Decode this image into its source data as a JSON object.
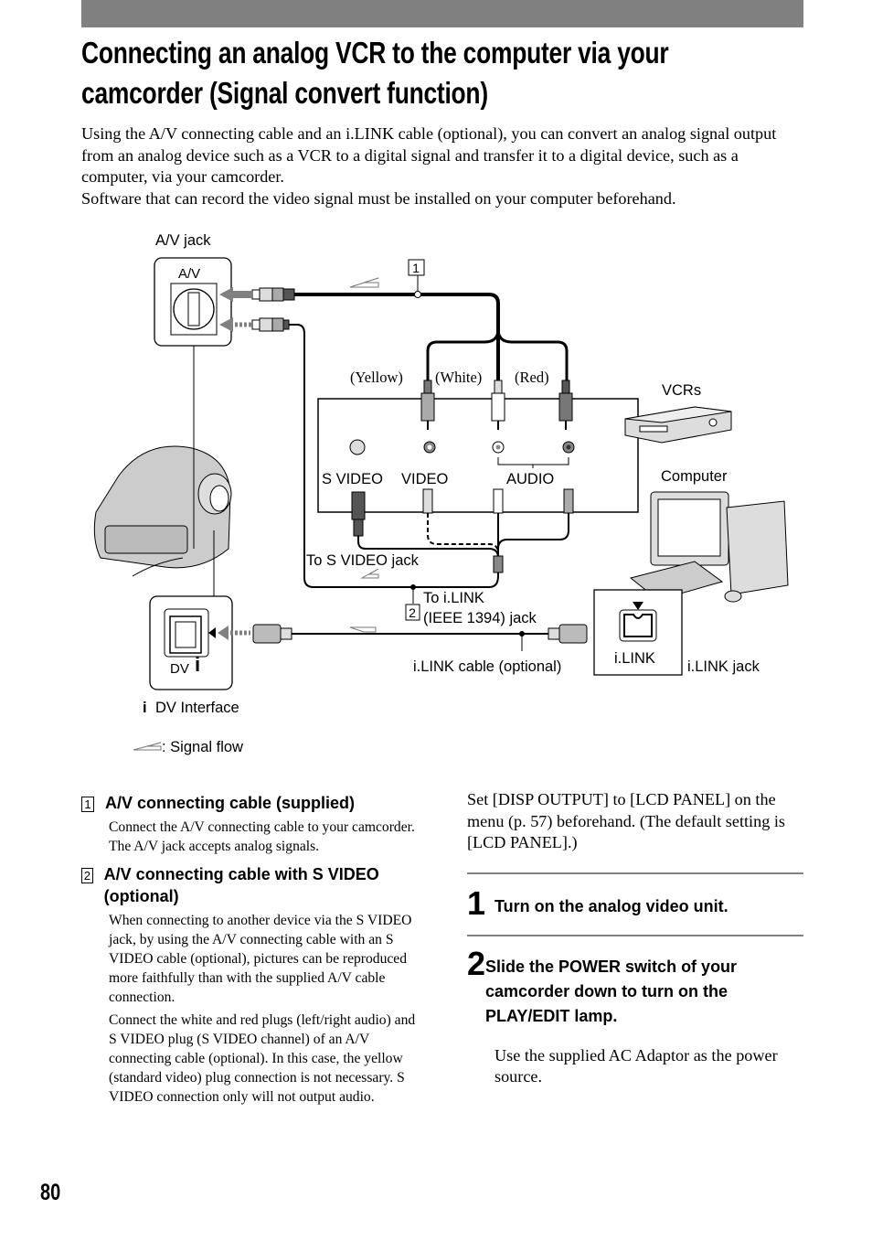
{
  "page": {
    "title_line1": "Connecting an analog VCR to the computer via your",
    "title_line2": "camcorder (Signal convert function)",
    "intro": [
      "Using the A/V connecting cable and an i.LINK cable (optional), you can convert an analog signal output from an analog device such as a VCR to a digital signal and transfer it to a digital device, such as a computer, via your camcorder.",
      "Software that can record the video signal must be installed on your computer beforehand."
    ],
    "page_number": "80"
  },
  "diagram": {
    "av_jack_label": "A/V jack",
    "av_port_label": "A/V",
    "callout_1": "1",
    "callout_2": "2",
    "yellow": "(Yellow)",
    "white": "(White)",
    "red": "(Red)",
    "vcrs": "VCRs",
    "computer": "Computer",
    "s_video": "S VIDEO",
    "video": "VIDEO",
    "audio": "AUDIO",
    "to_s_video_jack": "To S VIDEO jack",
    "to_ilink_line1": "To i.LINK",
    "to_ilink_line2": "(IEEE 1394) jack",
    "ilink_cable": "i.LINK cable (optional)",
    "ilink_port": "i.LINK",
    "ilink_jack": "i.LINK jack",
    "dv_port": "DV",
    "dv_interface": "DV Interface",
    "signal_flow": ": Signal flow",
    "icons": [
      "camcorder-icon",
      "vcr-icon",
      "computer-icon",
      "av-jack-icon",
      "ilink-jack-icon",
      "dv-jack-icon",
      "ilink-logo-icon",
      "signal-flow-arrow-icon"
    ]
  },
  "items": [
    {
      "num": "1",
      "heading": "A/V connecting cable (supplied)",
      "paragraphs": [
        "Connect the A/V connecting cable to your camcorder. The A/V jack accepts analog signals."
      ]
    },
    {
      "num": "2",
      "heading": "A/V connecting cable with S VIDEO (optional)",
      "paragraphs": [
        "When connecting to another device via the S VIDEO jack, by using the A/V connecting cable with an S VIDEO cable (optional), pictures can be reproduced more faithfully than with the supplied A/V cable connection.",
        "Connect the white and red plugs (left/right audio) and S VIDEO plug (S VIDEO channel) of an A/V connecting cable (optional). In this case, the yellow (standard video) plug connection is not necessary. S VIDEO connection only will not output audio."
      ]
    }
  ],
  "right": {
    "note": "Set [DISP OUTPUT] to [LCD PANEL] on the menu (p. 57) beforehand. (The default setting is [LCD PANEL].)",
    "steps": [
      {
        "num": "1",
        "text": "Turn on the analog video unit.",
        "body": ""
      },
      {
        "num": "2",
        "text": "Slide the POWER switch of your camcorder down to turn on the PLAY/EDIT lamp.",
        "body": "Use the supplied AC Adaptor as the power source."
      }
    ]
  }
}
